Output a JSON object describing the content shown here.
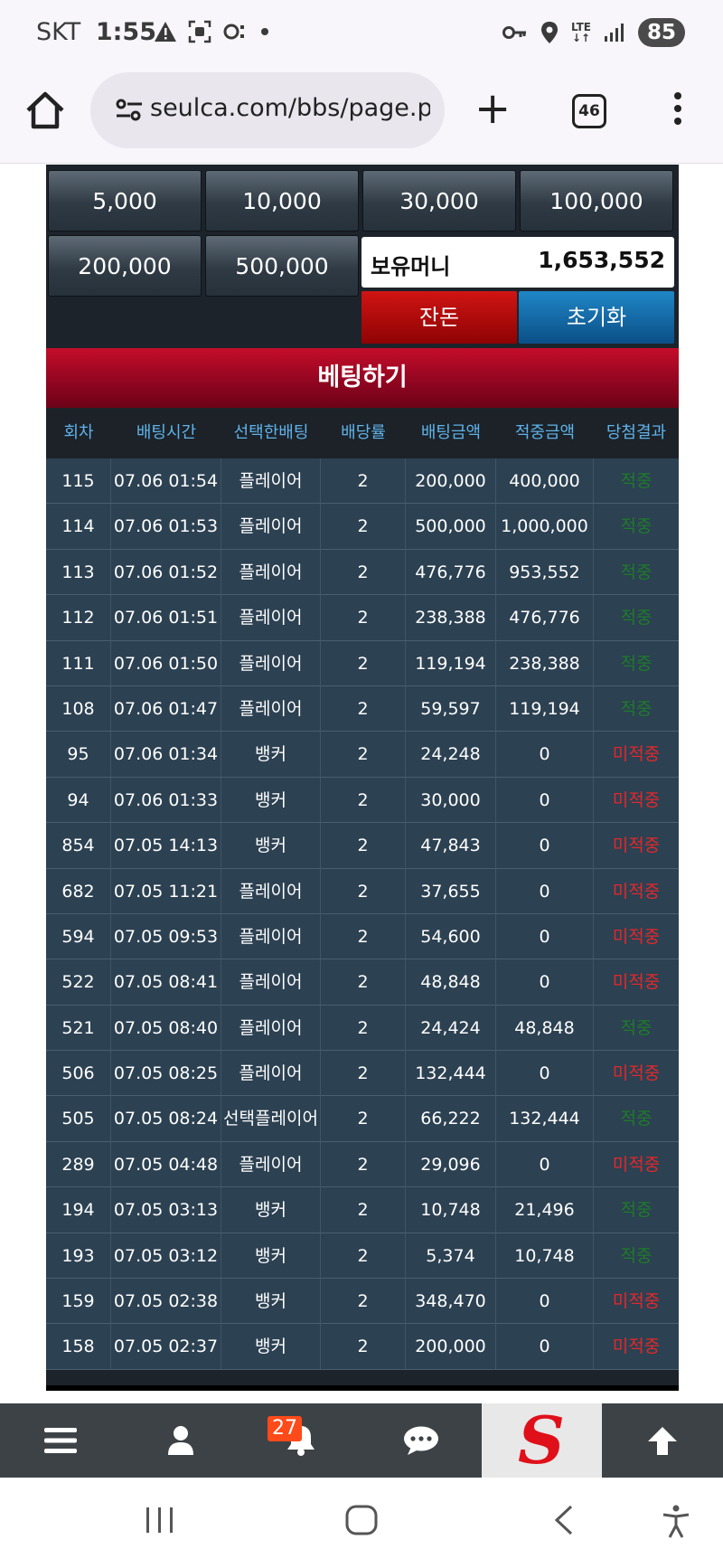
{
  "status_bar": {
    "carrier": "SKT",
    "time": "1:55",
    "battery": "85",
    "network": "LTE"
  },
  "browser": {
    "url": "seulca.com/bbs/page.php",
    "tab_count": "46"
  },
  "chips": [
    "5,000",
    "10,000",
    "30,000",
    "100,000",
    "200,000",
    "500,000"
  ],
  "balance": {
    "label": "보유머니",
    "value": "1,653,552"
  },
  "buttons": {
    "all_in": "잔돈",
    "reset": "초기화"
  },
  "bet_title": "베팅하기",
  "table": {
    "columns": [
      "회차",
      "배팅시간",
      "선택한배팅",
      "배당률",
      "배팅금액",
      "적중금액",
      "당첨결과"
    ],
    "rows": [
      [
        "115",
        "07.06 01:54",
        "플레이어",
        "2",
        "200,000",
        "400,000",
        "적중"
      ],
      [
        "114",
        "07.06 01:53",
        "플레이어",
        "2",
        "500,000",
        "1,000,000",
        "적중"
      ],
      [
        "113",
        "07.06 01:52",
        "플레이어",
        "2",
        "476,776",
        "953,552",
        "적중"
      ],
      [
        "112",
        "07.06 01:51",
        "플레이어",
        "2",
        "238,388",
        "476,776",
        "적중"
      ],
      [
        "111",
        "07.06 01:50",
        "플레이어",
        "2",
        "119,194",
        "238,388",
        "적중"
      ],
      [
        "108",
        "07.06 01:47",
        "플레이어",
        "2",
        "59,597",
        "119,194",
        "적중"
      ],
      [
        "95",
        "07.06 01:34",
        "뱅커",
        "2",
        "24,248",
        "0",
        "미적중"
      ],
      [
        "94",
        "07.06 01:33",
        "뱅커",
        "2",
        "30,000",
        "0",
        "미적중"
      ],
      [
        "854",
        "07.05 14:13",
        "뱅커",
        "2",
        "47,843",
        "0",
        "미적중"
      ],
      [
        "682",
        "07.05 11:21",
        "플레이어",
        "2",
        "37,655",
        "0",
        "미적중"
      ],
      [
        "594",
        "07.05 09:53",
        "플레이어",
        "2",
        "54,600",
        "0",
        "미적중"
      ],
      [
        "522",
        "07.05 08:41",
        "플레이어",
        "2",
        "48,848",
        "0",
        "미적중"
      ],
      [
        "521",
        "07.05 08:40",
        "플레이어",
        "2",
        "24,424",
        "48,848",
        "적중"
      ],
      [
        "506",
        "07.05 08:25",
        "플레이어",
        "2",
        "132,444",
        "0",
        "미적중"
      ],
      [
        "505",
        "07.05 08:24",
        "선택플레이어",
        "2",
        "66,222",
        "132,444",
        "적중"
      ],
      [
        "289",
        "07.05 04:48",
        "플레이어",
        "2",
        "29,096",
        "0",
        "미적중"
      ],
      [
        "194",
        "07.05 03:13",
        "뱅커",
        "2",
        "10,748",
        "21,496",
        "적중"
      ],
      [
        "193",
        "07.05 03:12",
        "뱅커",
        "2",
        "5,374",
        "10,748",
        "적중"
      ],
      [
        "159",
        "07.05 02:38",
        "뱅커",
        "2",
        "348,470",
        "0",
        "미적중"
      ],
      [
        "158",
        "07.05 02:37",
        "뱅커",
        "2",
        "200,000",
        "0",
        "미적중"
      ]
    ]
  },
  "bottom_nav": {
    "notification_count": "27",
    "icons": [
      "menu-icon",
      "user-icon",
      "bell-icon",
      "chat-icon",
      "logo",
      "arrow-up-icon"
    ]
  },
  "colors": {
    "win": "#1e7b2a",
    "lose": "#e3282a",
    "header_red": "#b0082a",
    "reset_blue": "#0b6aa8",
    "row_bg": "#2c4152"
  }
}
